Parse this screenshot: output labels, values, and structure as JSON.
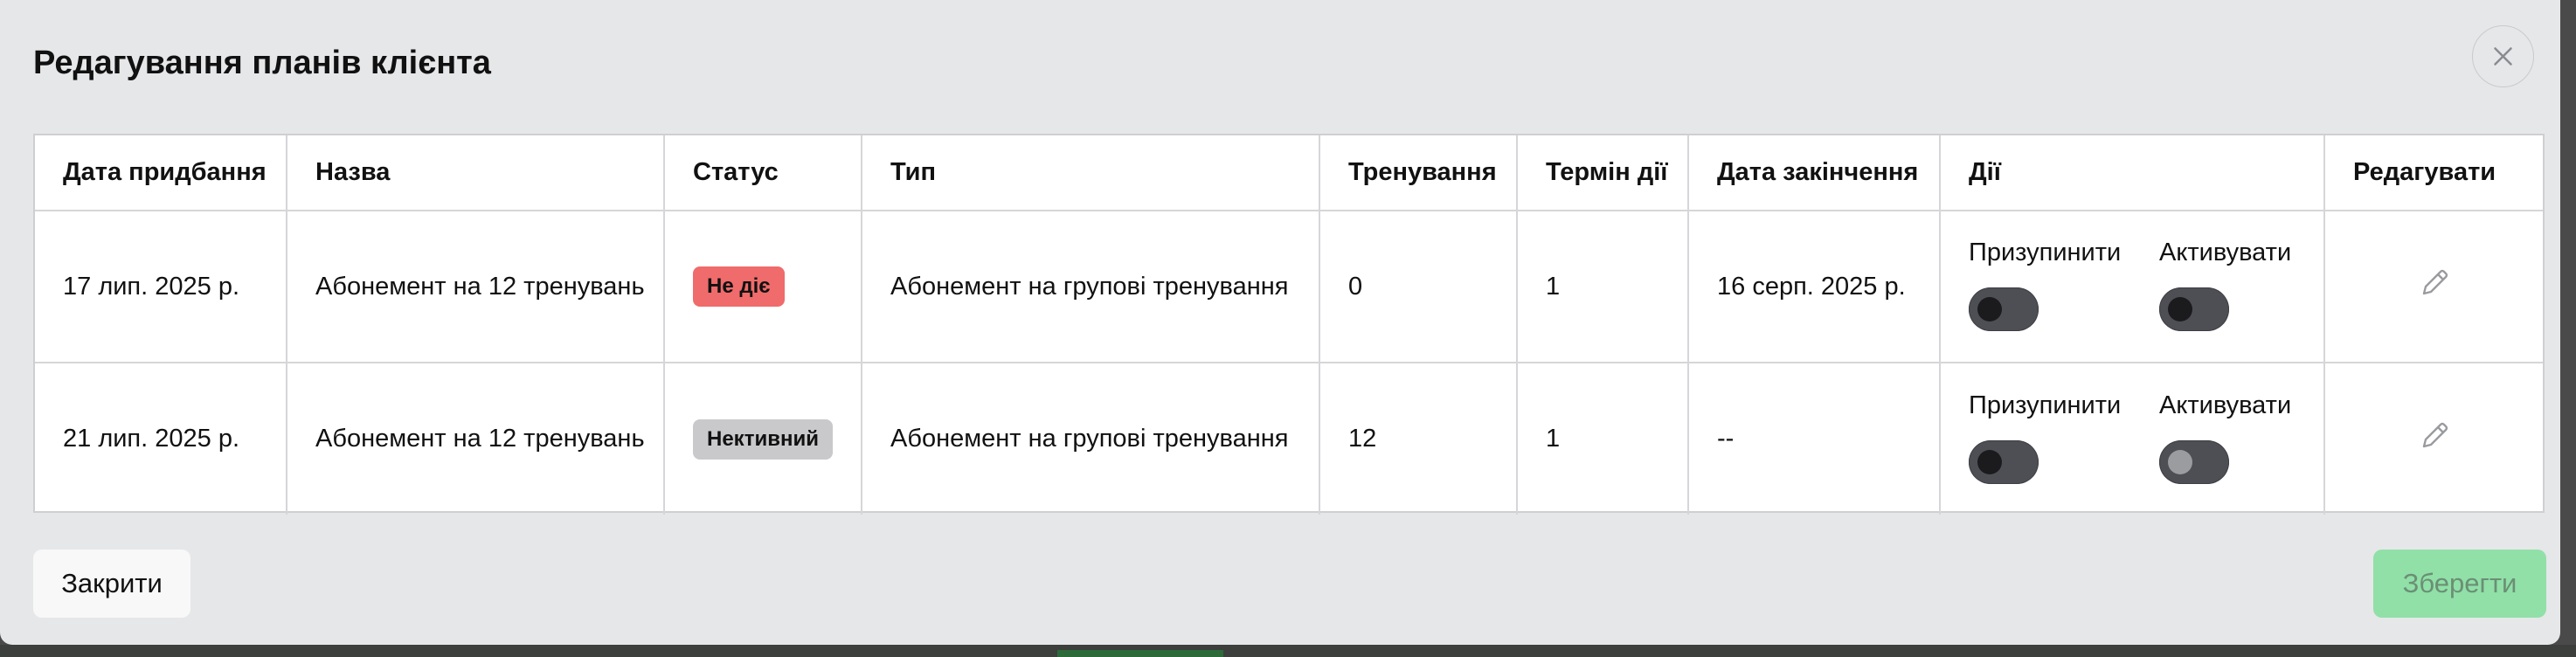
{
  "modal": {
    "title": "Редагування планів клієнта",
    "close_icon": "close-icon"
  },
  "table": {
    "headers": [
      "Дата придбання",
      "Назва",
      "Статус",
      "Тип",
      "Тренування",
      "Термін дії",
      "Дата закінчення",
      "Дії",
      "Редагувати"
    ],
    "rows": [
      {
        "purchase_date": "17 лип. 2025 р.",
        "name": "Абонемент на 12 тренувань",
        "status": "Не діє",
        "status_color": "#f06b6b",
        "type": "Абонемент на групові тренування",
        "trainings": "0",
        "duration": "1",
        "end_date": "16 серп. 2025 р.",
        "pause_label": "Призупинити",
        "activate_label": "Активувати",
        "pause_on": false,
        "activate_on": false,
        "edit_icon": "pencil-icon"
      },
      {
        "purchase_date": "21 лип. 2025 р.",
        "name": "Абонемент на 12 тренувань",
        "status": "Нективний",
        "status_color": "#c9c9cc",
        "type": "Абонемент на групові тренування",
        "trainings": "12",
        "duration": "1",
        "end_date": "--",
        "pause_label": "Призупинити",
        "activate_label": "Активувати",
        "pause_on": false,
        "activate_on": false,
        "edit_icon": "pencil-icon"
      }
    ]
  },
  "footer": {
    "close_label": "Закрити",
    "save_label": "Зберегти",
    "save_color": "#90e0a8"
  }
}
